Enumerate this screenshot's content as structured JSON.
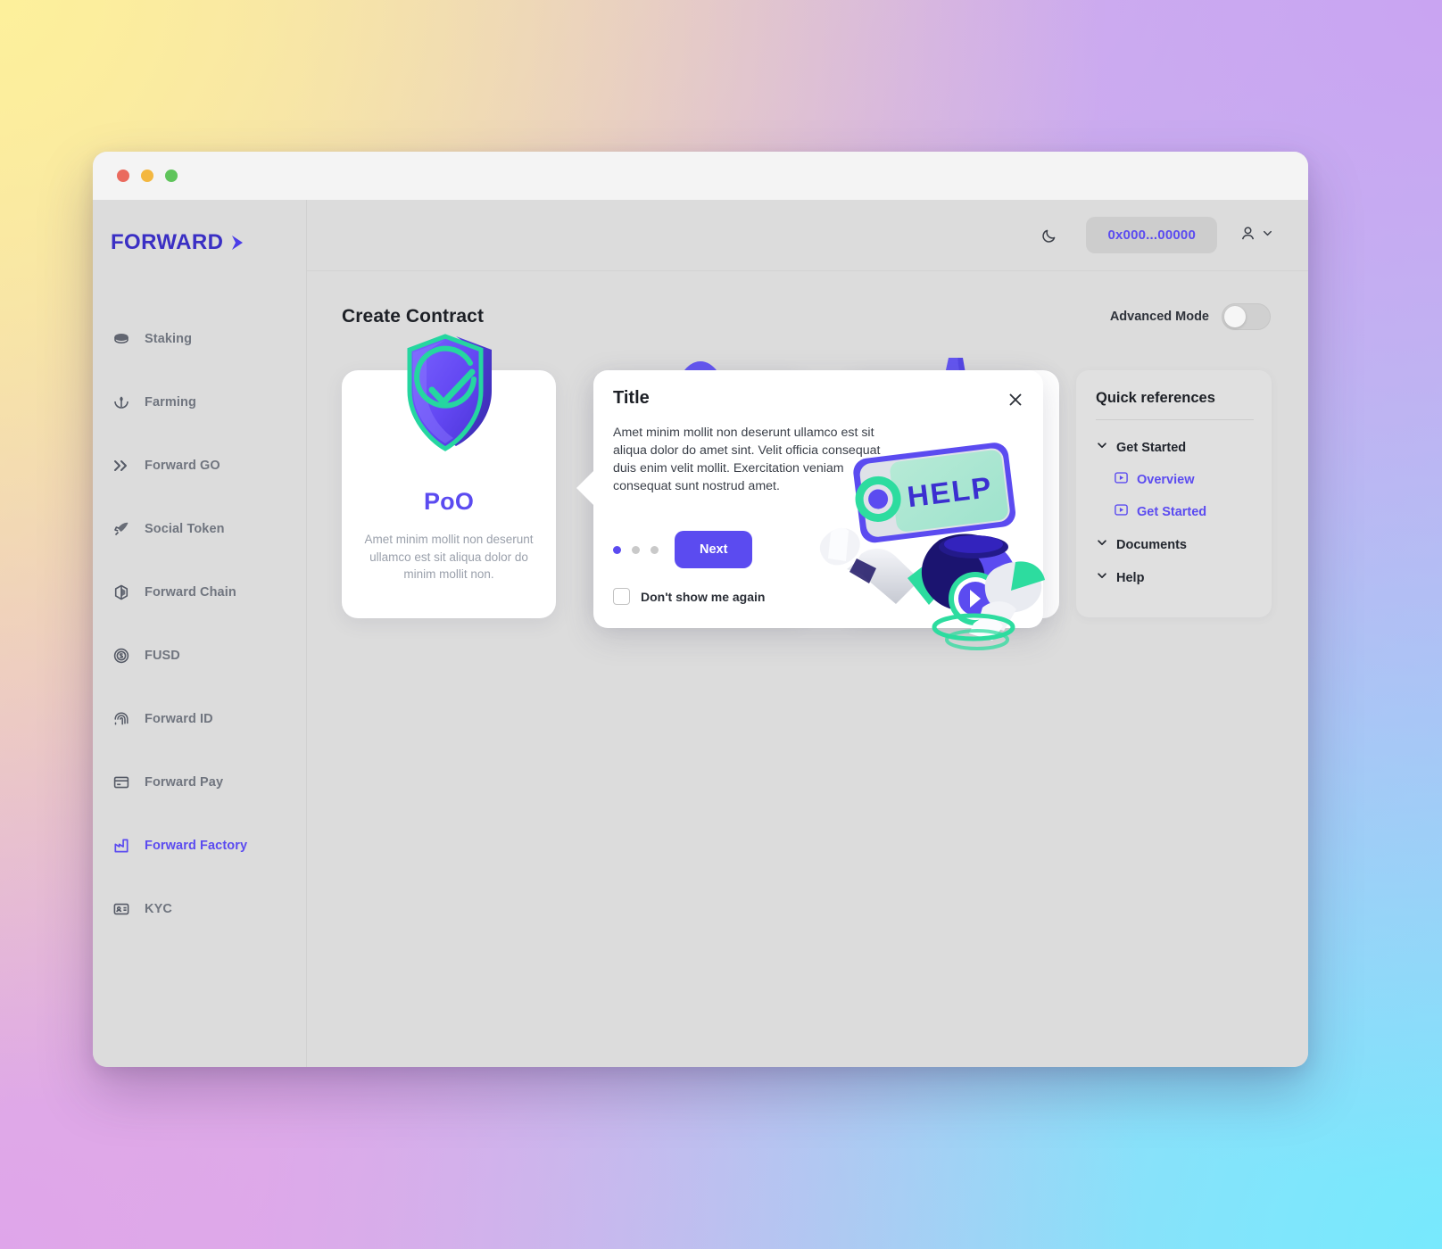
{
  "window": {
    "traffic_lights": [
      "close",
      "minimize",
      "maximize"
    ]
  },
  "brand": {
    "logo_text": "FORWARD"
  },
  "sidebar": {
    "items": [
      {
        "label": "Staking",
        "icon": "coin-stack-icon",
        "active": false
      },
      {
        "label": "Farming",
        "icon": "sprout-icon",
        "active": false
      },
      {
        "label": "Forward GO",
        "icon": "double-chevron-icon",
        "active": false
      },
      {
        "label": "Social Token",
        "icon": "rocket-icon",
        "active": false
      },
      {
        "label": "Forward Chain",
        "icon": "cube-icon",
        "active": false
      },
      {
        "label": "FUSD",
        "icon": "dollar-coin-icon",
        "active": false
      },
      {
        "label": "Forward ID",
        "icon": "fingerprint-icon",
        "active": false
      },
      {
        "label": "Forward Pay",
        "icon": "credit-card-icon",
        "active": false
      },
      {
        "label": "Forward Factory",
        "icon": "factory-icon",
        "active": true
      },
      {
        "label": "KYC",
        "icon": "id-card-icon",
        "active": false
      }
    ]
  },
  "topbar": {
    "theme_toggle_icon": "moon-icon",
    "wallet_address": "0x000...00000",
    "profile_icon": "user-icon",
    "profile_caret_icon": "chevron-down-icon"
  },
  "page": {
    "title": "Create Contract",
    "advanced_mode_label": "Advanced Mode",
    "advanced_mode_on": false
  },
  "cards": [
    {
      "title": "PoO",
      "description": "Amet minim mollit non deserunt ullamco est sit aliqua dolor do minim mollit non.",
      "art": "shield-check-3d-icon"
    }
  ],
  "tooltip": {
    "title": "Title",
    "body": "Amet minim mollit non deserunt ullamco est sit aliqua dolor do amet sint. Velit officia consequat duis enim velit mollit. Exercitation veniam consequat sunt nostrud amet.",
    "close_icon": "close-icon",
    "next_label": "Next",
    "dots_total": 3,
    "dots_active_index": 0,
    "checkbox_label": "Don't show me again",
    "checkbox_checked": false,
    "robot_sign_text": "HELP"
  },
  "quick_references": {
    "title": "Quick references",
    "groups": [
      {
        "label": "Get Started",
        "icon": "chevron-down-icon",
        "links": [
          {
            "label": "Overview",
            "icon": "video-play-icon"
          },
          {
            "label": "Get Started",
            "icon": "video-play-icon"
          }
        ]
      },
      {
        "label": "Documents",
        "icon": "chevron-down-icon",
        "links": []
      },
      {
        "label": "Help",
        "icon": "chevron-down-icon",
        "links": []
      }
    ]
  },
  "colors": {
    "accent": "#5b4bf0",
    "accent_deep": "#3a2fc4",
    "mint": "#2ddc9f",
    "surface": "#dcdcdc",
    "card": "#ffffff",
    "text": "#1d2026",
    "muted": "#9aa0ab"
  }
}
